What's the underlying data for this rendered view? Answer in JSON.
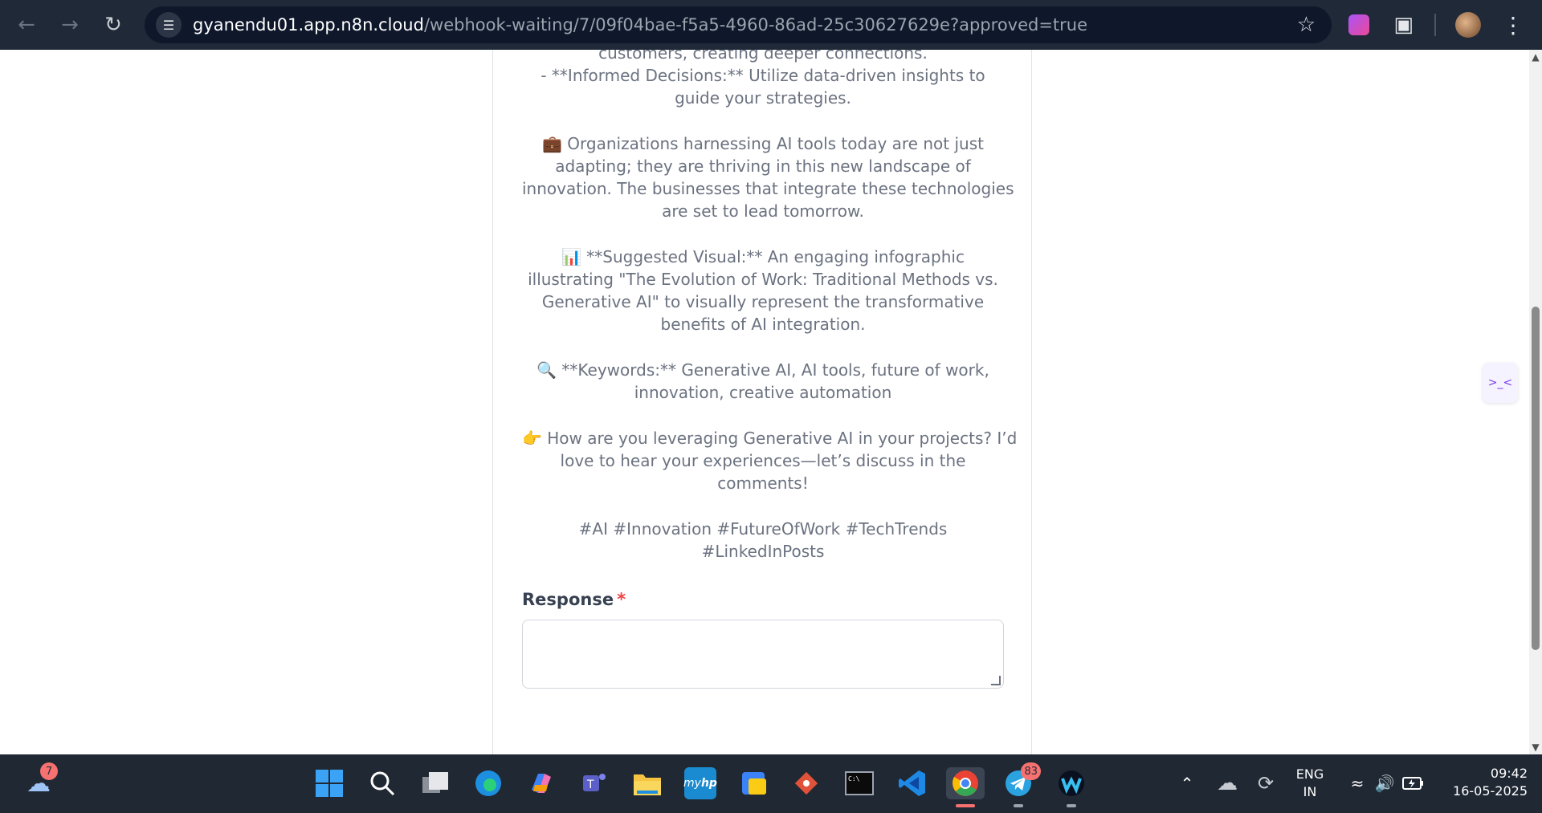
{
  "browser": {
    "url_host": "gyanendu01.app.n8n.cloud",
    "url_path": "/webhook-waiting/7/09f04bae-f5a5-4960-86ad-25c30627629e?approved=true"
  },
  "message": {
    "lines": [
      [
        "customers, creating deeper connections.",
        "- **Informed Decisions:** Utilize data-driven insights to",
        "guide your strategies."
      ],
      [
        "💼 Organizations harnessing AI tools today are not just",
        "adapting; they are thriving in this new landscape of",
        "innovation. The businesses that integrate these technologies",
        "are set to lead tomorrow."
      ],
      [
        "📊 **Suggested Visual:** An engaging infographic",
        "illustrating \"The Evolution of Work: Traditional Methods vs.",
        "Generative AI\" to visually represent the transformative",
        "benefits of AI integration."
      ],
      [
        "🔍 **Keywords:** Generative AI, AI tools, future of work,",
        "innovation, creative automation"
      ],
      [
        "👉 How are you leveraging Generative AI in your projects? I’d",
        "love to hear your experiences—let’s discuss in the",
        "comments!"
      ],
      [
        "#AI #Innovation #FutureOfWork #TechTrends",
        "#LinkedInPosts"
      ]
    ]
  },
  "form": {
    "response_label": "Response",
    "required_mark": "*",
    "response_value": ""
  },
  "side_widget": {
    "glyph": ">_<"
  },
  "taskbar": {
    "weather_badge": "7",
    "telegram_badge": "83",
    "lang_line1": "ENG",
    "lang_line2": "IN",
    "time": "09:42",
    "date": "16-05-2025"
  }
}
